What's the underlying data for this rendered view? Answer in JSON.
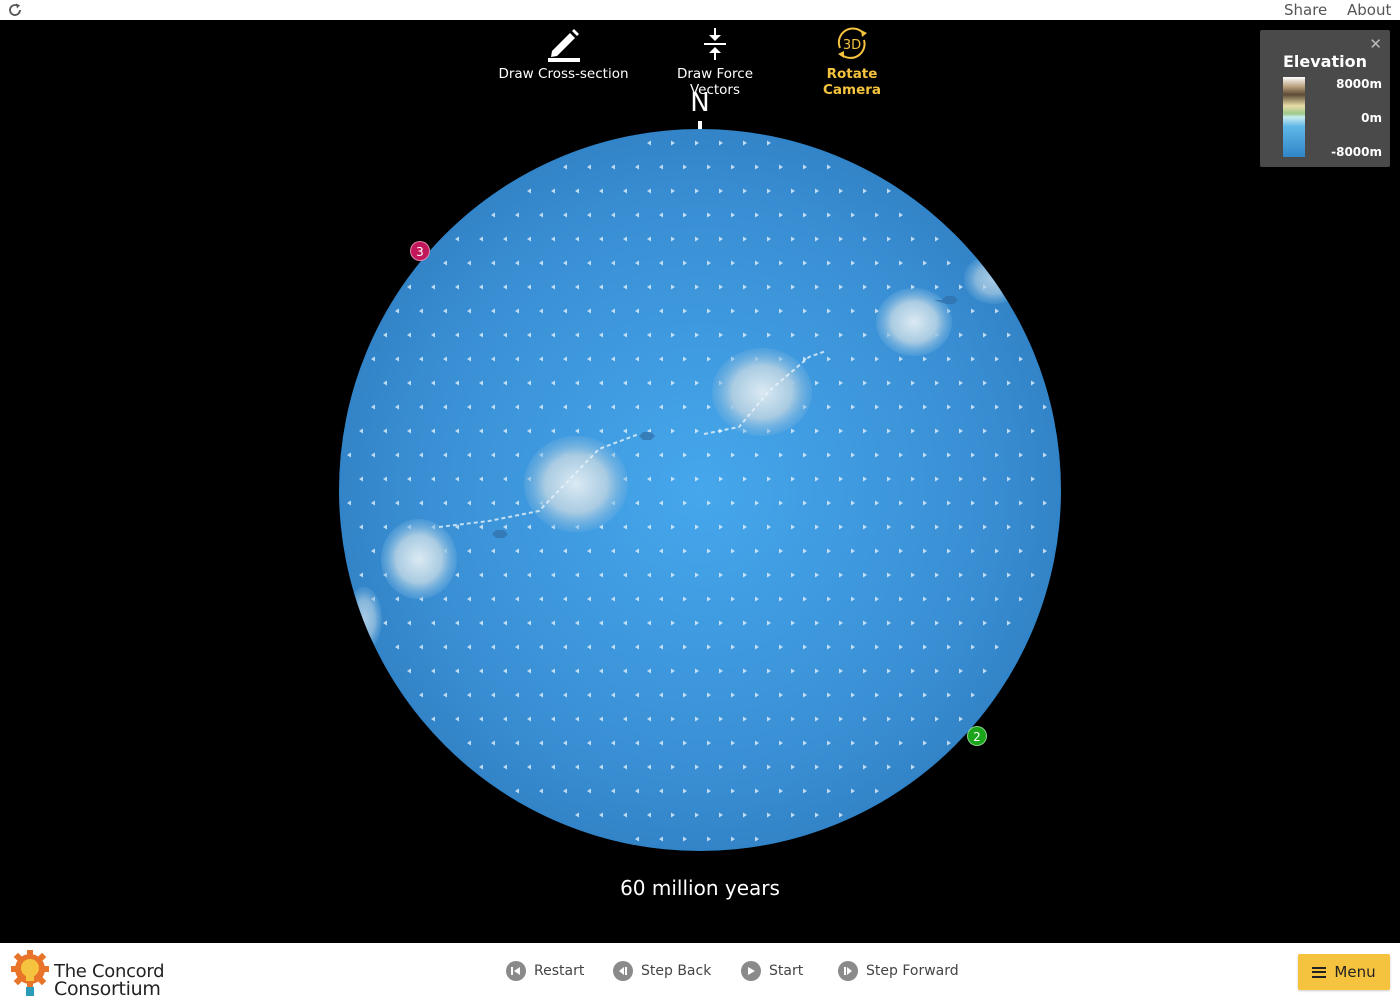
{
  "topbar": {
    "share_label": "Share",
    "about_label": "About"
  },
  "tools": [
    {
      "label": "Draw Cross-section",
      "icon": "pencil-icon"
    },
    {
      "label": "Draw Force Vectors",
      "icon": "compress-arrows-icon"
    },
    {
      "label": "Rotate Camera",
      "icon": "rotate-3d-icon",
      "icon_text": "3D",
      "active": true
    }
  ],
  "compass": {
    "north_label": "N"
  },
  "markers": [
    {
      "label": "3",
      "color": "#c2185b"
    },
    {
      "label": "2",
      "color": "#1aa51a"
    }
  ],
  "time": {
    "label": "60 million years"
  },
  "legend": {
    "title": "Elevation",
    "max_label": "8000m",
    "mid_label": "0m",
    "min_label": "-8000m",
    "close_icon": "close-icon"
  },
  "controls": [
    {
      "label": "Restart",
      "icon": "restart-icon"
    },
    {
      "label": "Step Back",
      "icon": "step-back-icon"
    },
    {
      "label": "Start",
      "icon": "play-icon"
    },
    {
      "label": "Step Forward",
      "icon": "step-forward-icon"
    }
  ],
  "menu": {
    "label": "Menu"
  },
  "brand": {
    "line1": "The Concord",
    "line2": "Consortium"
  },
  "colors": {
    "accent": "#f6c33f",
    "ocean": "#3a8fd4",
    "panel": "#4a4a4a"
  }
}
